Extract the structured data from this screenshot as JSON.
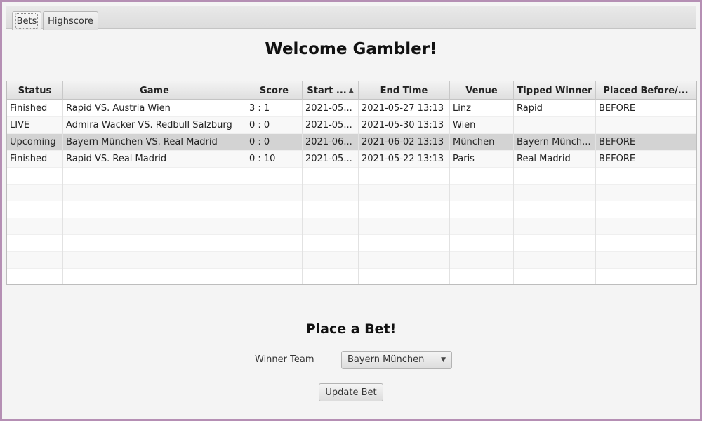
{
  "tabs": [
    {
      "label": "Bets",
      "selected": true
    },
    {
      "label": "Highscore",
      "selected": false
    }
  ],
  "heading": "Welcome Gambler!",
  "table": {
    "columns": [
      "Status",
      "Game",
      "Score",
      "Start ...",
      "End Time",
      "Venue",
      "Tipped Winner",
      "Placed Before/..."
    ],
    "sort_column": "Start ...",
    "sort_indicator": "▲",
    "rows": [
      [
        "Finished",
        "Rapid VS. Austria Wien",
        "3 : 1",
        "2021-05...",
        "2021-05-27 13:13",
        "Linz",
        "Rapid",
        "BEFORE"
      ],
      [
        "LIVE",
        "Admira Wacker VS. Redbull Salzburg",
        "0 : 0",
        "2021-05...",
        "2021-05-30 13:13",
        "Wien",
        "",
        ""
      ],
      [
        "Upcoming",
        "Bayern München VS. Real Madrid",
        "0 : 0",
        "2021-06...",
        "2021-06-02 13:13",
        "München",
        "Bayern Münch...",
        "BEFORE"
      ],
      [
        "Finished",
        "Rapid VS. Real Madrid",
        "0 : 10",
        "2021-05...",
        "2021-05-22 13:13",
        "Paris",
        "Real Madrid",
        "BEFORE"
      ]
    ],
    "selected_row": 2
  },
  "bet": {
    "title": "Place a Bet!",
    "winner_label": "Winner Team",
    "winner_value": "Bayern München",
    "update_label": "Update Bet"
  }
}
